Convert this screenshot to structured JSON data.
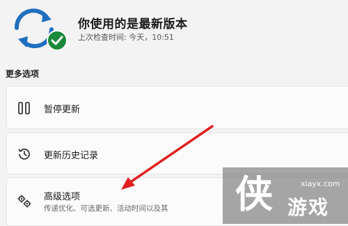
{
  "header": {
    "title": "你使用的是最新版本",
    "last_checked": "上次检查时间: 今天，10:51",
    "icon": "sync-check-icon"
  },
  "more_options": {
    "label": "更多选项",
    "items": [
      {
        "label": "暂停更新",
        "icon": "pause-icon"
      },
      {
        "label": "更新历史记录",
        "icon": "history-icon"
      },
      {
        "label": "高级选项",
        "description": "传递优化、可选更新、活动时间以及其",
        "icon": "gears-icon"
      }
    ]
  },
  "watermark": {
    "char": "侠",
    "brand": "游戏",
    "url": "xiayx.com"
  },
  "colors": {
    "accent": "#1f6fc0",
    "success": "#1a8a3a",
    "annotation": "#e01f1f"
  }
}
